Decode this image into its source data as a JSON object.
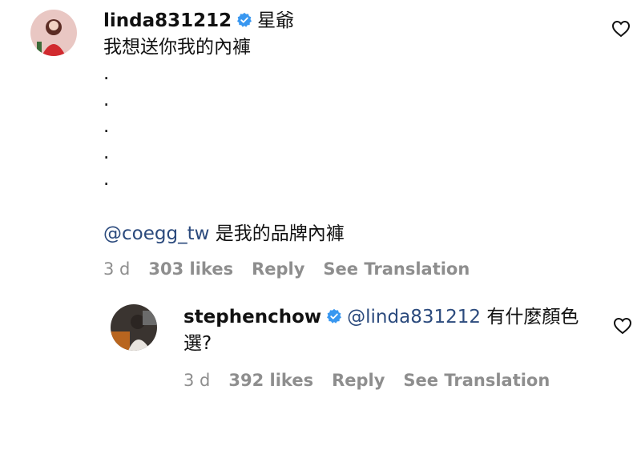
{
  "comment": {
    "username": "linda831212",
    "inline_text": "星爺",
    "body": "我想送你我的內褲",
    "dots": [
      ".",
      ".",
      ".",
      ".",
      "."
    ],
    "mention": "@coegg_tw",
    "mention_text": "是我的品牌內褲",
    "meta": {
      "time": "3 d",
      "likes": "303 likes",
      "reply": "Reply",
      "translate": "See Translation"
    },
    "like_icon": "heart-outline-icon"
  },
  "reply": {
    "username": "stephenchow",
    "mention": "@linda831212",
    "text_line1": "有什麼顏色",
    "text_line2": "選?",
    "meta": {
      "time": "3 d",
      "likes": "392 likes",
      "reply": "Reply",
      "translate": "See Translation"
    },
    "like_icon": "heart-outline-icon"
  },
  "colors": {
    "verified": "#3897f0",
    "mention": "#2b4a7d",
    "meta": "#8e8e8e"
  }
}
